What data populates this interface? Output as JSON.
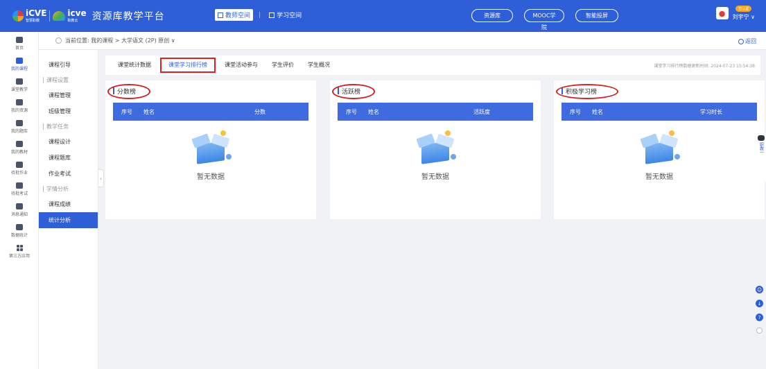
{
  "header": {
    "logo_text_1": "iCVE",
    "logo_sub_1": "智慧职教",
    "logo_text_2": "icve",
    "logo_sub_2": "职教云",
    "site_title": "资源库教学平台",
    "spaces": [
      {
        "label": "教师空间",
        "active": true
      },
      {
        "label": "学习空间",
        "active": false
      }
    ],
    "pills": [
      "资源库",
      "MOOC学院",
      "智能投屏"
    ],
    "user": {
      "badge": "已认证",
      "name": "刘宇宁"
    },
    "accent": "#2e5fd9"
  },
  "iconnav": [
    {
      "label": "首页",
      "icon": "home-icon"
    },
    {
      "label": "我的课程",
      "icon": "course-icon",
      "active": true
    },
    {
      "label": "课堂教学",
      "icon": "classroom-icon"
    },
    {
      "label": "我的资源",
      "icon": "resource-icon"
    },
    {
      "label": "我的题库",
      "icon": "question-bank-icon"
    },
    {
      "label": "我的教材",
      "icon": "textbook-icon"
    },
    {
      "label": "待批作业",
      "icon": "homework-icon"
    },
    {
      "label": "待批考试",
      "icon": "exam-icon"
    },
    {
      "label": "消息通知",
      "icon": "message-icon"
    },
    {
      "label": "数据统计",
      "icon": "stats-icon"
    },
    {
      "label": "第三方应用",
      "icon": "apps-icon"
    }
  ],
  "breadcrumb": {
    "text": "当前位置: 我的课程 > 大学语文 (2P) 原创 ∨",
    "back": "返回"
  },
  "submenu": {
    "items": [
      {
        "type": "item",
        "label": "课程引导"
      },
      {
        "type": "group",
        "label": "课程设置"
      },
      {
        "type": "item",
        "label": "课程管理"
      },
      {
        "type": "item",
        "label": "班级管理"
      },
      {
        "type": "group",
        "label": "教学任务"
      },
      {
        "type": "item",
        "label": "课程设计"
      },
      {
        "type": "item",
        "label": "课程题库"
      },
      {
        "type": "item",
        "label": "作业考试"
      },
      {
        "type": "group",
        "label": "学情分析"
      },
      {
        "type": "item",
        "label": "课程成绩"
      },
      {
        "type": "item",
        "label": "统计分析",
        "active": true
      }
    ]
  },
  "tabs": [
    {
      "label": "课堂统计数据"
    },
    {
      "label": "课堂学习排行榜",
      "active": true
    },
    {
      "label": "课堂活动参与"
    },
    {
      "label": "学生评价"
    },
    {
      "label": "学生概况"
    }
  ],
  "update_time": "课堂学习排行榜数据更新时间: 2024-07-23 15:54:38",
  "panels": [
    {
      "title": "分数榜",
      "col_seq": "序号",
      "col_name": "姓名",
      "col_value": "分数",
      "empty": "暂无数据"
    },
    {
      "title": "活跃榜",
      "col_seq": "序号",
      "col_name": "姓名",
      "col_value": "活跃度",
      "empty": "暂无数据"
    },
    {
      "title": "积极学习榜",
      "col_seq": "序号",
      "col_name": "姓名",
      "col_value": "学习时长",
      "empty": "暂无数据"
    }
  ],
  "float": {
    "robot_label": "职教一"
  }
}
